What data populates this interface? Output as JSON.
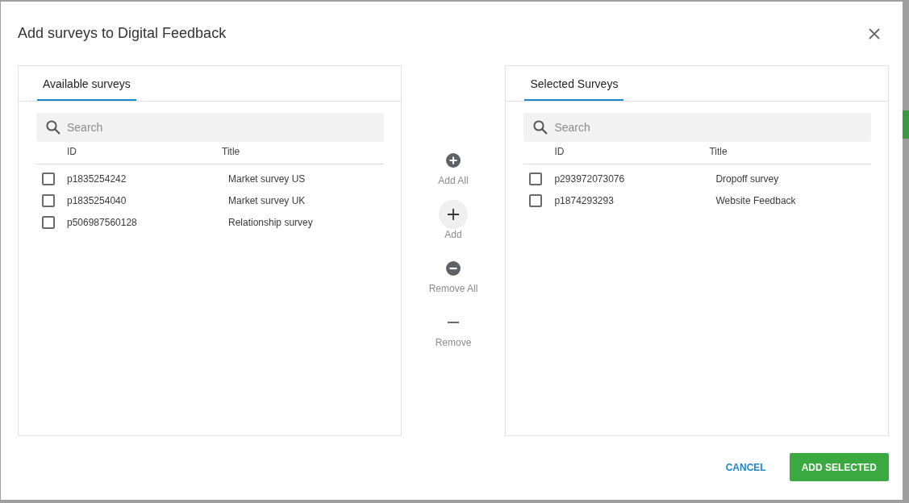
{
  "dialog": {
    "title": "Add surveys to Digital Feedback"
  },
  "panels": [
    {
      "tabs": [
        {
          "label": "Available surveys",
          "selected": true
        }
      ],
      "search": {
        "placeholder": "Search"
      },
      "columns": [
        "ID",
        "Title"
      ],
      "rows": [
        {
          "checked": false,
          "cells": [
            "p1835254242",
            "Market survey US"
          ]
        },
        {
          "checked": false,
          "cells": [
            "p1835254040",
            "Market survey UK"
          ]
        },
        {
          "checked": false,
          "cells": [
            "p506987560128",
            "Relationship survey"
          ]
        }
      ]
    },
    {
      "tabs": [
        {
          "label": "Selected Surveys",
          "selected": true
        }
      ],
      "search": {
        "placeholder": "Search"
      },
      "columns": [
        "ID",
        "Title"
      ],
      "rows": [
        {
          "checked": false,
          "cells": [
            "p293972073076",
            "Dropoff survey"
          ]
        },
        {
          "checked": false,
          "cells": [
            "p1874293293",
            "Website Feedback"
          ]
        }
      ]
    }
  ],
  "transfer_actions": [
    {
      "kind": "add_all",
      "label": "Add All",
      "focused": false
    },
    {
      "kind": "add",
      "label": "Add",
      "focused": true
    },
    {
      "kind": "remove_all",
      "label": "Remove All",
      "focused": false
    },
    {
      "kind": "remove",
      "label": "Remove",
      "focused": false
    }
  ],
  "footer_buttons": [
    {
      "kind": "dismiss",
      "label": "CANCEL"
    },
    {
      "kind": "confirm",
      "label": "ADD SELECTED"
    }
  ]
}
